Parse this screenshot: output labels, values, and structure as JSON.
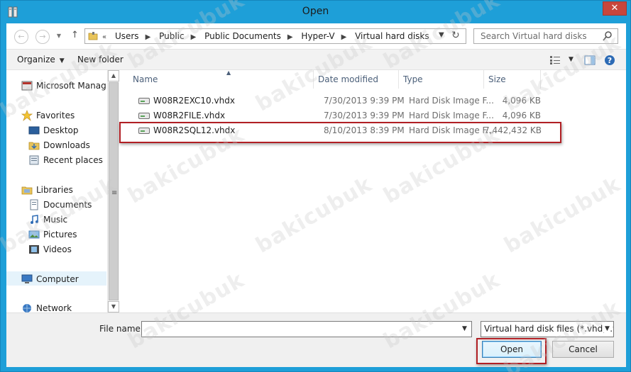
{
  "window": {
    "title": "Open",
    "close_glyph": "✕"
  },
  "nav": {
    "breadcrumbs": [
      "Users",
      "Public",
      "Public Documents",
      "Hyper-V",
      "Virtual hard disks"
    ],
    "breadcrumb_overflow": "«",
    "search_placeholder": "Search Virtual hard disks"
  },
  "toolbar": {
    "organize_label": "Organize",
    "new_folder_label": "New folder"
  },
  "sidebar": {
    "items": [
      {
        "label": "Microsoft Management Console",
        "icon": "mmc-icon"
      },
      {
        "label": "Favorites",
        "icon": "star-icon"
      },
      {
        "label": "Desktop",
        "icon": "desktop-icon"
      },
      {
        "label": "Downloads",
        "icon": "downloads-icon"
      },
      {
        "label": "Recent places",
        "icon": "recent-places-icon"
      },
      {
        "label": "Libraries",
        "icon": "libraries-icon"
      },
      {
        "label": "Documents",
        "icon": "documents-icon"
      },
      {
        "label": "Music",
        "icon": "music-icon"
      },
      {
        "label": "Pictures",
        "icon": "pictures-icon"
      },
      {
        "label": "Videos",
        "icon": "videos-icon"
      },
      {
        "label": "Computer",
        "icon": "computer-icon"
      },
      {
        "label": "Network",
        "icon": "network-icon"
      }
    ]
  },
  "columns": {
    "name": "Name",
    "date": "Date modified",
    "type": "Type",
    "size": "Size"
  },
  "files": [
    {
      "name": "W08R2EXC10.vhdx",
      "date": "7/30/2013 9:39 PM",
      "type": "Hard Disk Image F...",
      "size": "4,096 KB"
    },
    {
      "name": "W08R2FILE.vhdx",
      "date": "7/30/2013 9:39 PM",
      "type": "Hard Disk Image F...",
      "size": "4,096 KB"
    },
    {
      "name": "W08R2SQL12.vhdx",
      "date": "8/10/2013 8:39 PM",
      "type": "Hard Disk Image F...",
      "size": "7,442,432 KB"
    }
  ],
  "footer": {
    "file_name_label": "File name:",
    "file_name_value": "",
    "filter_value": "Virtual hard disk files   (*.vhd;*.vhdx)",
    "open_label": "Open",
    "cancel_label": "Cancel"
  },
  "watermark": "bakicubuk",
  "colors": {
    "chrome": "#1e9fd8",
    "close": "#c7463c",
    "highlight": "#b11f24",
    "header_text": "#4c607a"
  }
}
